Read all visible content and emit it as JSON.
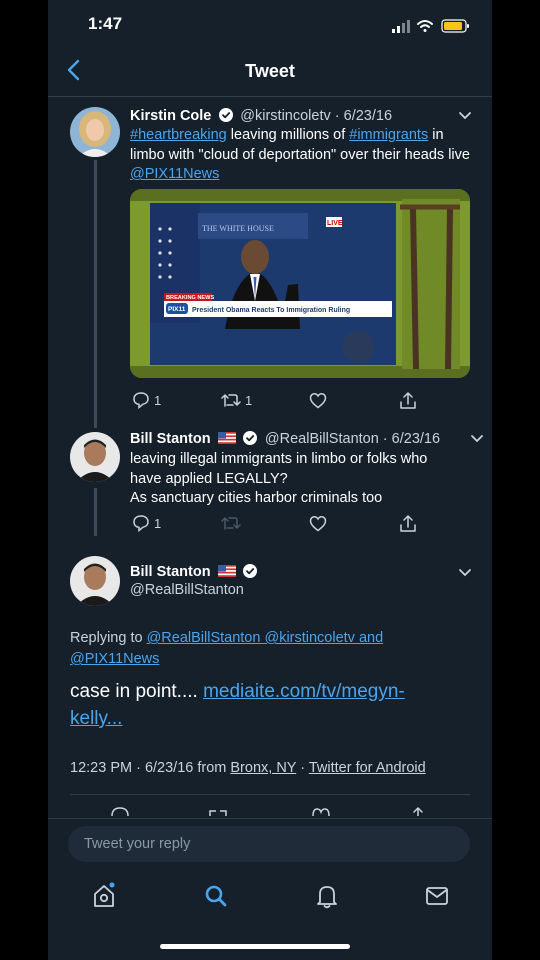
{
  "status_bar": {
    "time": "1:47"
  },
  "nav": {
    "title": "Tweet"
  },
  "tweet1": {
    "name": "Kirstin Cole",
    "handle_date": "@kirstincoletv · 6/23/16",
    "text_parts": [
      {
        "t": "#heartbreaking",
        "link": true
      },
      {
        "t": " leaving millions of ",
        "link": false
      },
      {
        "t": "#immigrants",
        "link": true
      },
      {
        "t": " in limbo with \"cloud of deportation\" over their heads live ",
        "link": false
      },
      {
        "t": "@PIX11News",
        "link": true
      }
    ],
    "media": {
      "banner_top": "BREAKING NEWS",
      "banner_main": "President Obama Reacts To Immigration Ruling",
      "channel": "PIX11",
      "live": "LIVE",
      "wall_text": "THE WHITE HOUSE"
    },
    "counts": {
      "replies": "1",
      "retweets": "1",
      "likes": ""
    }
  },
  "tweet2": {
    "name": "Bill Stanton",
    "handle_date": "@RealBillStanton · 6/23/16",
    "text_lines": [
      "leaving illegal immigrants in limbo or folks who",
      "have applied LEGALLY?",
      "As sanctuary cities harbor criminals too"
    ],
    "counts": {
      "replies": "1"
    }
  },
  "tweet3": {
    "name": "Bill Stanton",
    "handle": "@RealBillStanton",
    "replying_prefix": "Replying to ",
    "replying_links_line1": "@RealBillStanton @kirstincoletv and",
    "replying_links_line2": "@PIX11News",
    "body_prefix": "case in point.... ",
    "body_link_line1": "mediaite.com/tv/megyn-",
    "body_link_line2": "kelly...",
    "time_date": "12:23 PM · 6/23/16 from ",
    "location": "Bronx, NY",
    "sep": " · ",
    "source": "Twitter for Android"
  },
  "reply_input": {
    "placeholder": "Tweet your reply"
  },
  "colors": {
    "background": "#15202b",
    "link": "#4aa5ef",
    "text_secondary": "#c9d3dc",
    "battery": "#f5c518"
  }
}
